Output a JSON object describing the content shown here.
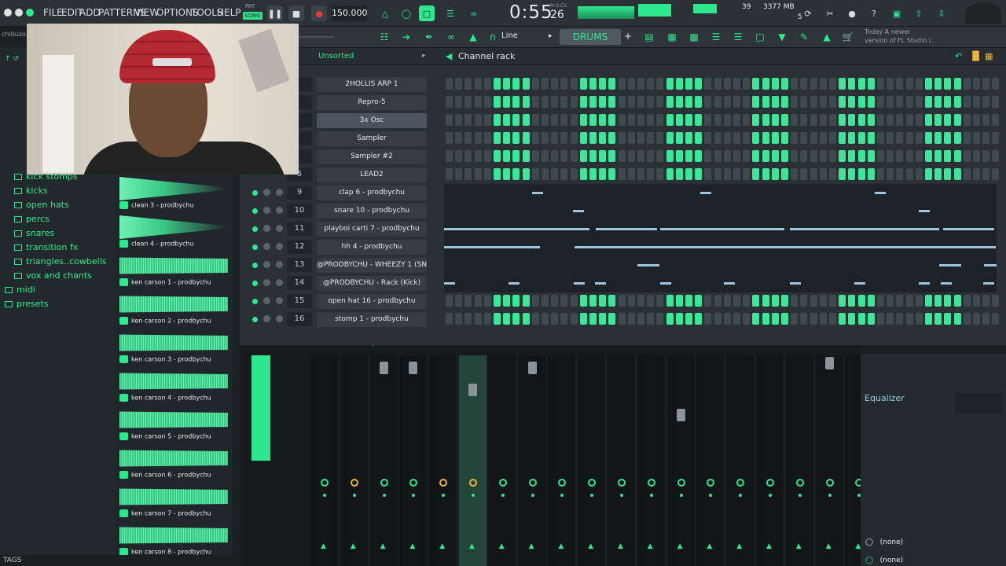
{
  "app": {
    "menu": [
      "FILE",
      "EDIT",
      "ADD",
      "PATTERNS",
      "VIEW",
      "OPTIONS",
      "TOOLS",
      "HELP"
    ],
    "pat_label": "PAT",
    "song_label": "SONG",
    "tempo": "150.000",
    "time": "0:55",
    "time_ms": "26",
    "time_unit": "M:S:CS",
    "cpu": "39",
    "memory": "3377 MB",
    "polyphony": "5",
    "news_line1": "Today  A newer",
    "news_line2": "version of FL Studio i..",
    "snap": "Line",
    "pattern": "DRUMS"
  },
  "browser": {
    "user_path": "chibuzo",
    "folders": [
      "kick stomps",
      "kicks",
      "open hats",
      "percs",
      "snares",
      "transition fx",
      "triangles..cowbells",
      "vox and chants",
      "midi",
      "presets"
    ],
    "tags_label": "TAGS"
  },
  "samples": [
    "clean 3 - prodbychu",
    "clean 4 - prodbychu",
    "ken carson 1 - prodbychu",
    "ken carson 2 - prodbychu",
    "ken carson 3 - prodbychu",
    "ken carson 4 - prodbychu",
    "ken carson 5 - prodbychu",
    "ken carson 6 - prodbychu",
    "ken carson 7 - prodbychu",
    "ken carson 8 - prodbychu"
  ],
  "rack": {
    "filter": "Unsorted",
    "title": "Channel rack",
    "channels": [
      {
        "num": "",
        "name": "2HOLLIS ARP 1",
        "mode": "steps",
        "pattern": "0000011110000011110000011110000011110000011110000011110000"
      },
      {
        "num": "",
        "name": "Repro-5",
        "mode": "steps",
        "pattern": "0000011110000011110000011110000011110000011110000011110000"
      },
      {
        "num": "",
        "name": "3x Osc",
        "mode": "steps",
        "pattern": "0000011110000011110000011110000011110000011110000011110000",
        "selected": true
      },
      {
        "num": "",
        "name": "Sampler",
        "mode": "steps",
        "pattern": "0000011110000011110000011110000011110000011110000011110000"
      },
      {
        "num": "",
        "name": "Sampler #2",
        "mode": "steps",
        "pattern": "0000011110000011110000011110000011110000011110000011110000"
      },
      {
        "num": "5",
        "name": "LEAD2",
        "mode": "steps",
        "pattern": "0000011110000011110000011110000011110000011110000011110000"
      },
      {
        "num": "9",
        "name": "clap 6 - prodbychu",
        "mode": "piano"
      },
      {
        "num": "10",
        "name": "snare 10 - prodbychu",
        "mode": "piano"
      },
      {
        "num": "11",
        "name": "playboi carti 7 - prodbychu",
        "mode": "piano"
      },
      {
        "num": "12",
        "name": "hh 4 - prodbychu",
        "mode": "piano"
      },
      {
        "num": "13",
        "name": "@PRODBYCHU - WHEEZY 1 (SN)",
        "mode": "piano"
      },
      {
        "num": "14",
        "name": "@PRODBYCHU - Rack (Kick)",
        "mode": "piano"
      },
      {
        "num": "15",
        "name": "open hat 16 - prodbychu",
        "mode": "steps",
        "pattern": "0000011110000011110000011110000011110000011110000011110000"
      },
      {
        "num": "16",
        "name": "stomp 1 - prodbychu",
        "mode": "steps",
        "pattern": "0000011110000011110000011110000011110000011110000011110000"
      }
    ]
  },
  "mixer": {
    "plugin": "Equalizer",
    "slot1": "(none)",
    "slot2": "(none)"
  },
  "colors": {
    "accent": "#2ee88e",
    "step_on": "#3ee59b",
    "step_off": "#3f494f",
    "note": "#9ec4df"
  }
}
